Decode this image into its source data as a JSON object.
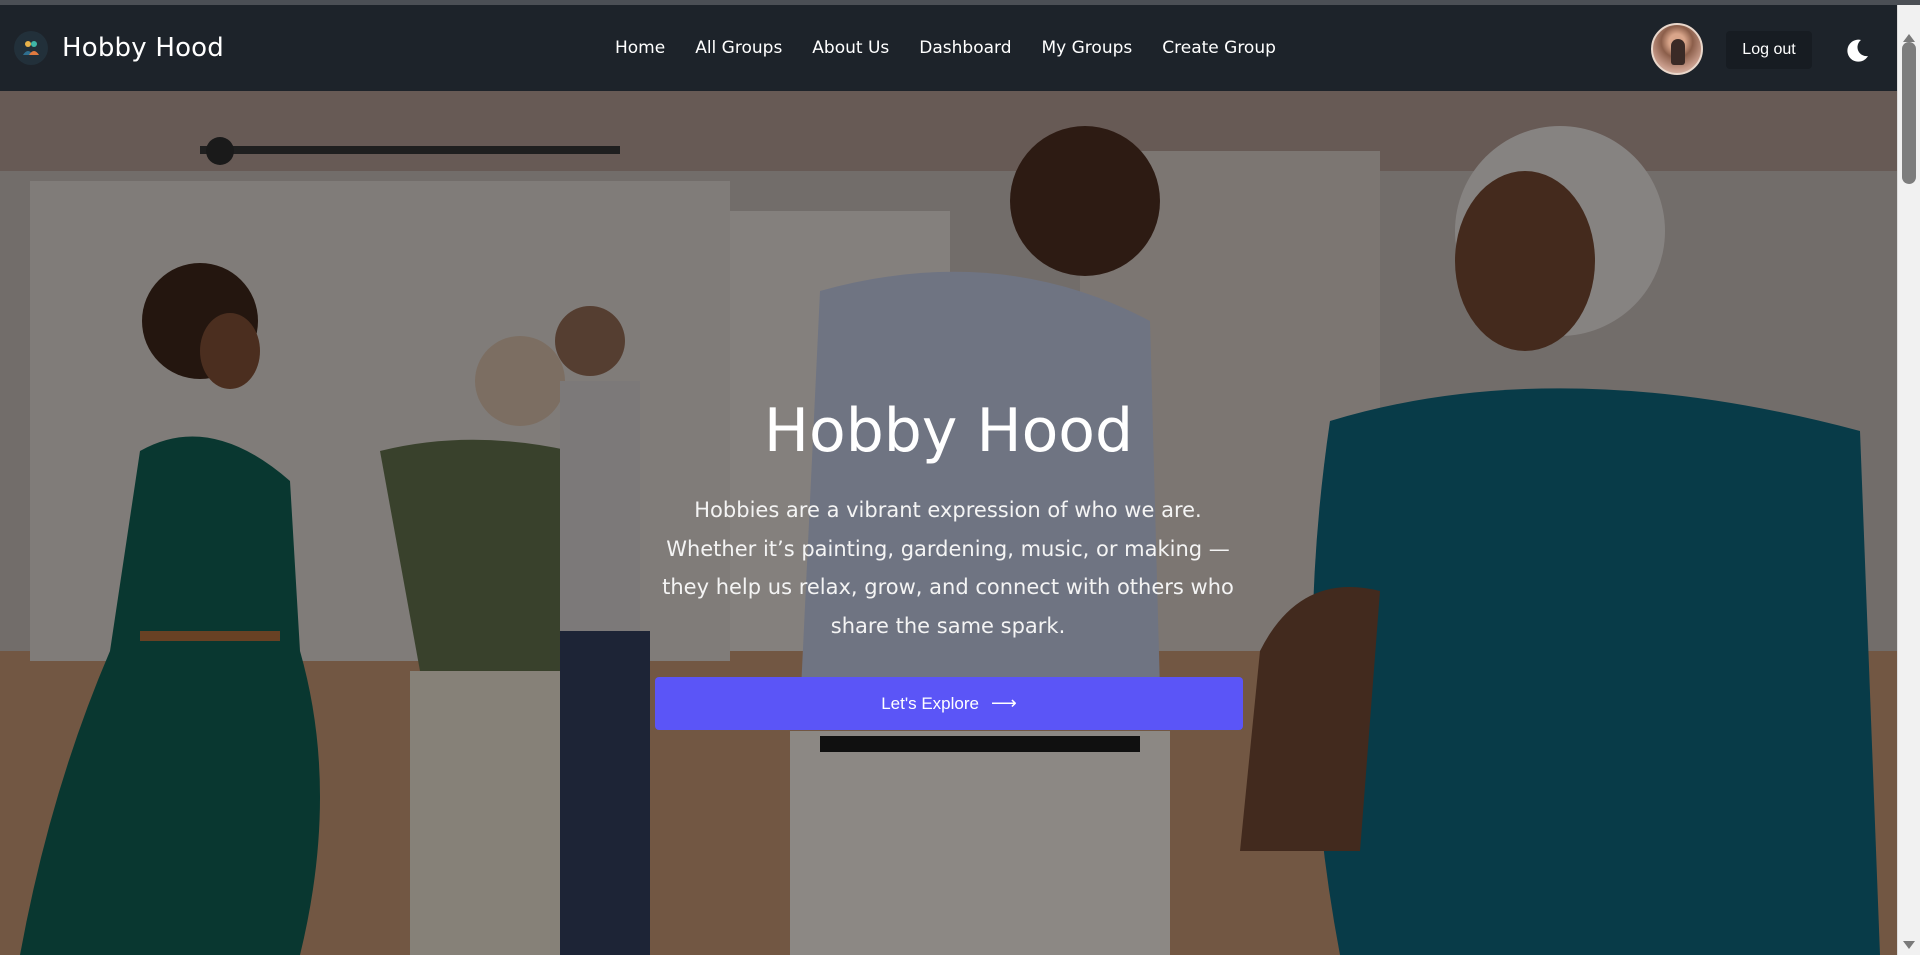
{
  "brand": {
    "name": "Hobby Hood",
    "logo_icon": "hobby-hood-logo"
  },
  "nav": {
    "links": [
      "Home",
      "All Groups",
      "About Us",
      "Dashboard",
      "My Groups",
      "Create Group"
    ]
  },
  "user": {
    "avatar": "user-avatar",
    "logout_label": "Log out",
    "theme_icon": "moon-icon"
  },
  "hero": {
    "title": "Hobby Hood",
    "text": "Hobbies are a vibrant expression of who we are. Whether it’s painting, gardening, music, or making — they help us relax, grow, and connect with others who share the same spark.",
    "cta_label": "Let's Explore",
    "cta_icon": "arrow-right-icon"
  },
  "colors": {
    "navbar": "#1d232a",
    "accent": "#5b55f7"
  }
}
